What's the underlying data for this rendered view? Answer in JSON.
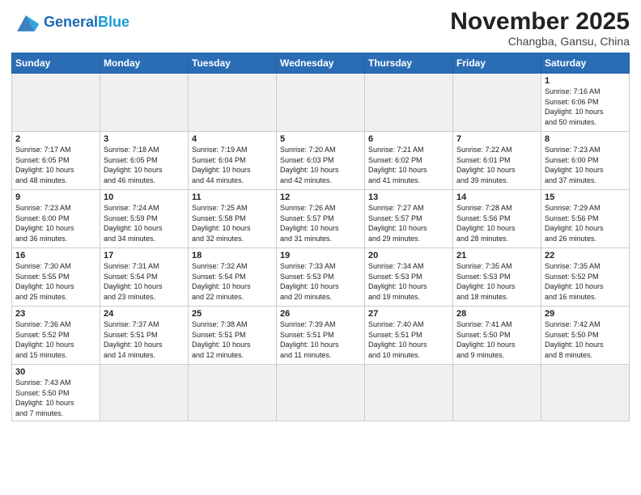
{
  "header": {
    "logo_general": "General",
    "logo_blue": "Blue",
    "month_year": "November 2025",
    "location": "Changba, Gansu, China"
  },
  "weekdays": [
    "Sunday",
    "Monday",
    "Tuesday",
    "Wednesday",
    "Thursday",
    "Friday",
    "Saturday"
  ],
  "weeks": [
    [
      {
        "num": "",
        "info": ""
      },
      {
        "num": "",
        "info": ""
      },
      {
        "num": "",
        "info": ""
      },
      {
        "num": "",
        "info": ""
      },
      {
        "num": "",
        "info": ""
      },
      {
        "num": "",
        "info": ""
      },
      {
        "num": "1",
        "info": "Sunrise: 7:16 AM\nSunset: 6:06 PM\nDaylight: 10 hours\nand 50 minutes."
      }
    ],
    [
      {
        "num": "2",
        "info": "Sunrise: 7:17 AM\nSunset: 6:05 PM\nDaylight: 10 hours\nand 48 minutes."
      },
      {
        "num": "3",
        "info": "Sunrise: 7:18 AM\nSunset: 6:05 PM\nDaylight: 10 hours\nand 46 minutes."
      },
      {
        "num": "4",
        "info": "Sunrise: 7:19 AM\nSunset: 6:04 PM\nDaylight: 10 hours\nand 44 minutes."
      },
      {
        "num": "5",
        "info": "Sunrise: 7:20 AM\nSunset: 6:03 PM\nDaylight: 10 hours\nand 42 minutes."
      },
      {
        "num": "6",
        "info": "Sunrise: 7:21 AM\nSunset: 6:02 PM\nDaylight: 10 hours\nand 41 minutes."
      },
      {
        "num": "7",
        "info": "Sunrise: 7:22 AM\nSunset: 6:01 PM\nDaylight: 10 hours\nand 39 minutes."
      },
      {
        "num": "8",
        "info": "Sunrise: 7:23 AM\nSunset: 6:00 PM\nDaylight: 10 hours\nand 37 minutes."
      }
    ],
    [
      {
        "num": "9",
        "info": "Sunrise: 7:23 AM\nSunset: 6:00 PM\nDaylight: 10 hours\nand 36 minutes."
      },
      {
        "num": "10",
        "info": "Sunrise: 7:24 AM\nSunset: 5:59 PM\nDaylight: 10 hours\nand 34 minutes."
      },
      {
        "num": "11",
        "info": "Sunrise: 7:25 AM\nSunset: 5:58 PM\nDaylight: 10 hours\nand 32 minutes."
      },
      {
        "num": "12",
        "info": "Sunrise: 7:26 AM\nSunset: 5:57 PM\nDaylight: 10 hours\nand 31 minutes."
      },
      {
        "num": "13",
        "info": "Sunrise: 7:27 AM\nSunset: 5:57 PM\nDaylight: 10 hours\nand 29 minutes."
      },
      {
        "num": "14",
        "info": "Sunrise: 7:28 AM\nSunset: 5:56 PM\nDaylight: 10 hours\nand 28 minutes."
      },
      {
        "num": "15",
        "info": "Sunrise: 7:29 AM\nSunset: 5:56 PM\nDaylight: 10 hours\nand 26 minutes."
      }
    ],
    [
      {
        "num": "16",
        "info": "Sunrise: 7:30 AM\nSunset: 5:55 PM\nDaylight: 10 hours\nand 25 minutes."
      },
      {
        "num": "17",
        "info": "Sunrise: 7:31 AM\nSunset: 5:54 PM\nDaylight: 10 hours\nand 23 minutes."
      },
      {
        "num": "18",
        "info": "Sunrise: 7:32 AM\nSunset: 5:54 PM\nDaylight: 10 hours\nand 22 minutes."
      },
      {
        "num": "19",
        "info": "Sunrise: 7:33 AM\nSunset: 5:53 PM\nDaylight: 10 hours\nand 20 minutes."
      },
      {
        "num": "20",
        "info": "Sunrise: 7:34 AM\nSunset: 5:53 PM\nDaylight: 10 hours\nand 19 minutes."
      },
      {
        "num": "21",
        "info": "Sunrise: 7:35 AM\nSunset: 5:53 PM\nDaylight: 10 hours\nand 18 minutes."
      },
      {
        "num": "22",
        "info": "Sunrise: 7:35 AM\nSunset: 5:52 PM\nDaylight: 10 hours\nand 16 minutes."
      }
    ],
    [
      {
        "num": "23",
        "info": "Sunrise: 7:36 AM\nSunset: 5:52 PM\nDaylight: 10 hours\nand 15 minutes."
      },
      {
        "num": "24",
        "info": "Sunrise: 7:37 AM\nSunset: 5:51 PM\nDaylight: 10 hours\nand 14 minutes."
      },
      {
        "num": "25",
        "info": "Sunrise: 7:38 AM\nSunset: 5:51 PM\nDaylight: 10 hours\nand 12 minutes."
      },
      {
        "num": "26",
        "info": "Sunrise: 7:39 AM\nSunset: 5:51 PM\nDaylight: 10 hours\nand 11 minutes."
      },
      {
        "num": "27",
        "info": "Sunrise: 7:40 AM\nSunset: 5:51 PM\nDaylight: 10 hours\nand 10 minutes."
      },
      {
        "num": "28",
        "info": "Sunrise: 7:41 AM\nSunset: 5:50 PM\nDaylight: 10 hours\nand 9 minutes."
      },
      {
        "num": "29",
        "info": "Sunrise: 7:42 AM\nSunset: 5:50 PM\nDaylight: 10 hours\nand 8 minutes."
      }
    ],
    [
      {
        "num": "30",
        "info": "Sunrise: 7:43 AM\nSunset: 5:50 PM\nDaylight: 10 hours\nand 7 minutes."
      },
      {
        "num": "",
        "info": ""
      },
      {
        "num": "",
        "info": ""
      },
      {
        "num": "",
        "info": ""
      },
      {
        "num": "",
        "info": ""
      },
      {
        "num": "",
        "info": ""
      },
      {
        "num": "",
        "info": ""
      }
    ]
  ]
}
